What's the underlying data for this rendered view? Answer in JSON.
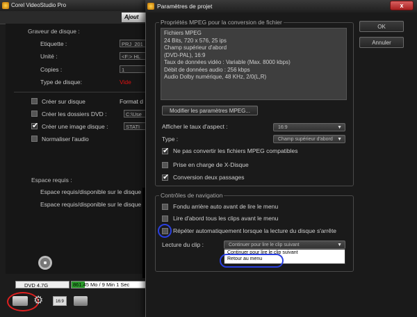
{
  "app": {
    "title": "Corel VideoStudio Pro",
    "ajout_label": "Ajout",
    "disc_writer_header": "Graveur de disque :",
    "fields": [
      {
        "label": "Etiquette :",
        "value": "PRJ_201"
      },
      {
        "label": "Unité :",
        "value": "<F:> HL"
      },
      {
        "label": "Copies :",
        "value": "1"
      }
    ],
    "disc_type_label": "Type de disque:",
    "disc_type_value": "Vide",
    "disc_type_color": "#e01010",
    "options": [
      {
        "label": "Créer sur disque",
        "checked": false,
        "extra": "Format d"
      },
      {
        "label": "Créer les dossiers DVD :",
        "checked": false,
        "extra": "C:\\Use"
      },
      {
        "label": "Créer une image disque :",
        "checked": true,
        "extra": "STATI"
      },
      {
        "label": "Normaliser l'audio",
        "checked": false,
        "extra": ""
      }
    ],
    "space_header": "Espace requis :",
    "space_lines": [
      "Espace requis/disponible sur le disque",
      "Espace requis/disponible sur le disque"
    ],
    "dvd_select": "DVD 4.7G",
    "size_text": "861.45 Mo / 9 Min 1 Sec",
    "size_fraction": 0.18,
    "preview_icon_text": "16:9"
  },
  "dialog": {
    "title": "Paramètres de projet",
    "close_label": "x",
    "ok_label": "OK",
    "cancel_label": "Annuler",
    "mpeg_group_title": "Propriétés MPEG pour la conversion de fichier",
    "mpeg_info": [
      "Fichiers MPEG",
      "24 Bits, 720 x 576, 25 ips",
      "Champ supérieur d'abord",
      "(DVD-PAL), 16:9",
      "Taux de données vidéo : Variable (Max. 8000 kbps)",
      "Débit de données audio : 256 kbps",
      "Audio Dolby numérique, 48 KHz, 2/0(L,R)"
    ],
    "modify_button": "Modifier les paramètres MPEG...",
    "aspect_label": "Afficher le taux d'aspect :",
    "aspect_value": "16:9",
    "type_label": "Type :",
    "type_value": "Champ supérieur d'abord",
    "mpeg_options": [
      {
        "label": "Ne pas convertir les fichiers MPEG compatibles",
        "checked": true
      },
      {
        "label": "Prise en charge de X-Disque",
        "checked": false
      },
      {
        "label": "Conversion deux passages",
        "checked": true
      }
    ],
    "nav_group_title": "Contrôles de navigation",
    "nav_options": [
      {
        "label": "Fondu arrière auto avant de lire le menu",
        "checked": false
      },
      {
        "label": "Lire d'abord tous les clips avant le menu",
        "checked": false
      },
      {
        "label": "Répéter automatiquement lorsque la lecture du disque s'arrête",
        "checked": false
      }
    ],
    "clip_label": "Lecture du clip :",
    "clip_value": "Continuer pour lire le clip suivant",
    "popup_items": [
      "Continuer pour lire le clip suivant",
      "Retour au menu"
    ]
  }
}
